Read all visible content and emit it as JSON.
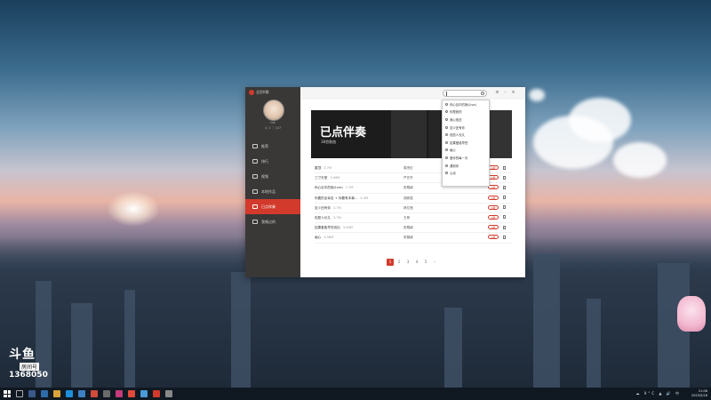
{
  "desktop": {
    "watermark_logo": "斗鱼",
    "room_label": "房间号",
    "room_number": "1368050"
  },
  "app": {
    "title": "全民K歌",
    "user": {
      "name": "ms",
      "stats": "◎ 1  ♡ 147"
    },
    "nav": [
      {
        "icon": "thumb-icon",
        "label": "推荐"
      },
      {
        "icon": "list-icon",
        "label": "排行"
      },
      {
        "icon": "camera-icon",
        "label": "视频"
      },
      {
        "icon": "folder-icon",
        "label": "本地作品"
      },
      {
        "icon": "mic-icon",
        "label": "已点伴奏",
        "active": true
      },
      {
        "icon": "history-icon",
        "label": "我唱过的"
      }
    ],
    "banner": {
      "title": "已点伴奏",
      "subtitle": "38首歌曲"
    },
    "songs": [
      {
        "title": "屋顶",
        "dur": "3.7M",
        "singer": "周杰伦"
      },
      {
        "title": "三寸天堂",
        "dur": "3.56M",
        "singer": "严艺丹"
      },
      {
        "title": "你心目中的她(Live)",
        "dur": "7.7M",
        "singer": "张靓颖"
      },
      {
        "title": "你要的全拿走 + 你要有本事...",
        "dur": "3.3M",
        "singer": "胡彦斌"
      },
      {
        "title": "至少还有你",
        "dur": "3.7M",
        "singer": "林忆莲"
      },
      {
        "title": "但愿人长久",
        "dur": "3.7M",
        "singer": "王菲"
      },
      {
        "title": "如果爱能早些说出",
        "dur": "3.56M",
        "singer": "张靓颖"
      },
      {
        "title": "画心",
        "dur": "3.56M",
        "singer": "张靓颖"
      }
    ],
    "sing_label": "K歌",
    "pages": [
      "1",
      "2",
      "3",
      "4",
      "5",
      "›"
    ],
    "dropdown": [
      "你心目中的她(Live)",
      "你是我的",
      "我心依旧",
      "至少还有你",
      "但愿人长久",
      "如果爱能早些",
      "画心",
      "爱你的每一天",
      "遇到你",
      "心动"
    ]
  },
  "taskbar": {
    "time": "21:06",
    "date": "2022/5/16",
    "tray": "☁ 9°C ▲ 🔊 中"
  },
  "colors": {
    "accent": "#d23a2c",
    "sidebar": "#3a3737"
  }
}
